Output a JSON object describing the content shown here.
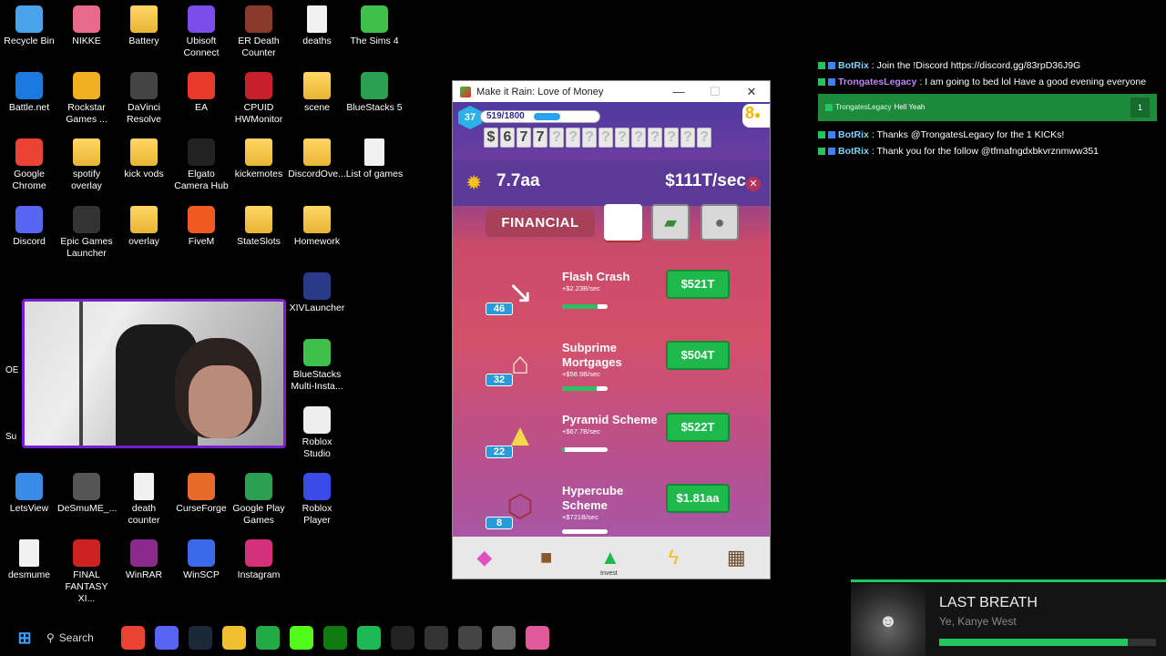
{
  "desktop": {
    "icons": [
      {
        "label": "Recycle Bin",
        "icon": "recycle-bin-icon"
      },
      {
        "label": "NIKKE",
        "icon": "nikke-icon"
      },
      {
        "label": "Battery",
        "icon": "folder-icon"
      },
      {
        "label": "Ubisoft Connect",
        "icon": "ubisoft-icon"
      },
      {
        "label": "ER Death Counter",
        "icon": "er-death-counter-icon"
      },
      {
        "label": "deaths",
        "icon": "document-icon"
      },
      {
        "label": "The Sims 4",
        "icon": "sims-icon"
      },
      {
        "label": "Battle.net",
        "icon": "battlenet-icon"
      },
      {
        "label": "Rockstar Games ...",
        "icon": "rockstar-icon"
      },
      {
        "label": "DaVinci Resolve",
        "icon": "davinci-icon"
      },
      {
        "label": "EA",
        "icon": "ea-icon"
      },
      {
        "label": "CPUID HWMonitor",
        "icon": "cpuid-icon"
      },
      {
        "label": "scene",
        "icon": "folder-icon"
      },
      {
        "label": "BlueStacks 5",
        "icon": "bluestacks-icon"
      },
      {
        "label": "Google Chrome",
        "icon": "chrome-icon"
      },
      {
        "label": "spotify overlay",
        "icon": "folder-icon"
      },
      {
        "label": "kick vods",
        "icon": "folder-icon"
      },
      {
        "label": "Elgato Camera Hub",
        "icon": "elgato-icon"
      },
      {
        "label": "kickemotes",
        "icon": "folder-icon"
      },
      {
        "label": "DiscordOve...",
        "icon": "folder-icon"
      },
      {
        "label": "List of games",
        "icon": "document-icon"
      },
      {
        "label": "Discord",
        "icon": "discord-icon"
      },
      {
        "label": "Epic Games Launcher",
        "icon": "epic-icon"
      },
      {
        "label": "overlay",
        "icon": "folder-icon"
      },
      {
        "label": "FiveM",
        "icon": "fivem-icon"
      },
      {
        "label": "StateSlots",
        "icon": "folder-icon"
      },
      {
        "label": "Homework",
        "icon": "folder-icon"
      },
      {
        "label": "XIVLauncher",
        "icon": "xivlauncher-icon"
      },
      {
        "label": "BlueStacks Multi-Insta...",
        "icon": "bluestacks-multi-icon"
      },
      {
        "label": "Roblox Studio",
        "icon": "roblox-studio-icon"
      },
      {
        "label": "LetsView",
        "icon": "letsview-icon"
      },
      {
        "label": "DeSmuME_...",
        "icon": "desmume-icon"
      },
      {
        "label": "death counter",
        "icon": "document-icon"
      },
      {
        "label": "CurseForge",
        "icon": "curseforge-icon"
      },
      {
        "label": "Google Play Games",
        "icon": "google-play-icon"
      },
      {
        "label": "Roblox Player",
        "icon": "roblox-icon"
      },
      {
        "label": "desmume",
        "icon": "document-icon"
      },
      {
        "label": "FINAL FANTASY XI...",
        "icon": "ffxi-icon"
      },
      {
        "label": "WinRAR",
        "icon": "winrar-icon"
      },
      {
        "label": "WinSCP",
        "icon": "winscp-icon"
      },
      {
        "label": "Instagram",
        "icon": "instagram-icon"
      }
    ],
    "partial_labels": [
      "OE",
      "Su"
    ]
  },
  "game_window": {
    "title": "Make it Rain: Love of Money",
    "controls": {
      "minimize": "—",
      "maximize": "☐",
      "close": "✕"
    },
    "level": "37",
    "xp": "519/1800",
    "xp_fraction": 0.29,
    "gold": "8",
    "odometer": [
      "$",
      "6",
      "7",
      "7",
      "?",
      "?",
      "?",
      "?",
      "?",
      "?",
      "?",
      "?",
      "?",
      "?"
    ],
    "money": "7.7aa",
    "rate": "$111T/sec",
    "category": "FINANCIAL",
    "businesses": [
      {
        "name": "Flash Crash",
        "income": "+$2.23B/sec",
        "count": "46",
        "price": "$521T",
        "progress": 0.78,
        "icon": "chart-down-icon"
      },
      {
        "name": "Subprime Mortgages",
        "income": "+$58.9B/sec",
        "count": "32",
        "price": "$504T",
        "progress": 0.76,
        "icon": "house-icon"
      },
      {
        "name": "Pyramid Scheme",
        "income": "+$67.7B/sec",
        "count": "22",
        "price": "$522T",
        "progress": 0.06,
        "icon": "pyramid-icon"
      },
      {
        "name": "Hypercube Scheme",
        "income": "+$721B/sec",
        "count": "8",
        "price": "$1.81aa",
        "progress": 0.0,
        "icon": "hypercube-icon"
      }
    ],
    "bottom_nav": {
      "invest_label": "Invest"
    }
  },
  "chat": [
    {
      "user": "BotRix",
      "message": ": Join the !Discord https://discord.gg/83rpD36J9G",
      "color": "#7dd3fc"
    },
    {
      "user": "TrongatesLegacy",
      "message": ": I am going to bed lol Have a good evening everyone",
      "color": "#c084fc"
    },
    {
      "user": "TrongatesLegacy",
      "message": "Hell Yeah",
      "color": "#d8ffe0",
      "highlight": true,
      "count": "1"
    },
    {
      "user": "BotRix",
      "message": ": Thanks @TrongatesLegacy for the 1 KICKs!",
      "color": "#7dd3fc"
    },
    {
      "user": "BotRix",
      "message": ": Thank you for the follow @tfmafngdxbkvrznmww351",
      "color": "#7dd3fc"
    }
  ],
  "now_playing": {
    "title": "LAST BREATH",
    "artist": "Ye, Kanye West",
    "progress": 0.87,
    "accent": "#22c55e"
  },
  "taskbar": {
    "search_label": "Search",
    "apps": [
      "chrome-icon",
      "discord-icon",
      "steam-icon",
      "file-explorer-icon",
      "app-green-icon",
      "app-kick-icon",
      "xbox-icon",
      "spotify-icon",
      "elgato-icon",
      "app-dots-icon",
      "app-obs-icon",
      "settings-icon",
      "make-it-rain-icon"
    ]
  }
}
